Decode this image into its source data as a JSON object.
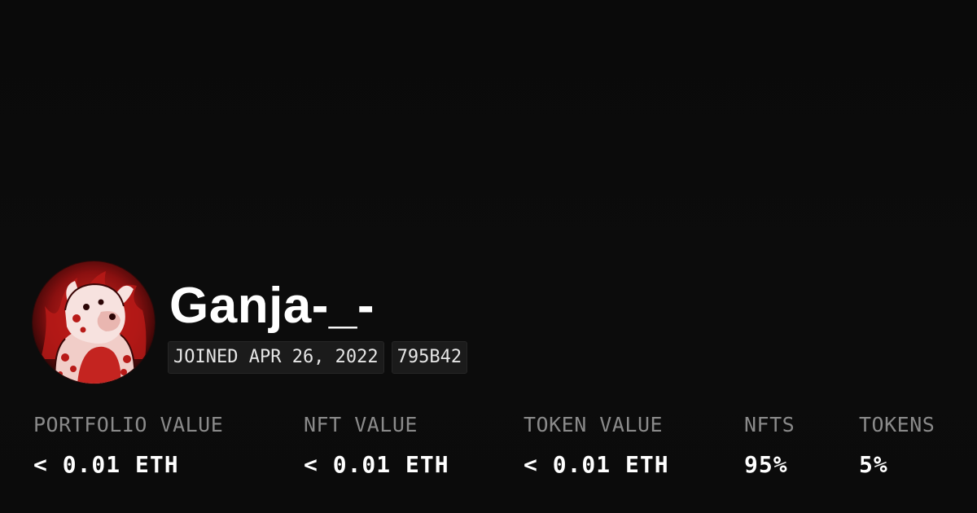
{
  "profile": {
    "username": "Ganja-_-",
    "joined": "JOINED APR 26, 2022",
    "address_short": "795B42",
    "avatar_icon": "avatar-image",
    "avatar_colors": {
      "base": "#1a0303",
      "dark_red": "#6e0c0c",
      "red": "#c8201e",
      "light": "#f4d7d4",
      "white": "#ffffff"
    }
  },
  "stats": [
    {
      "label": "PORTFOLIO VALUE",
      "value": "< 0.01 ETH"
    },
    {
      "label": "NFT VALUE",
      "value": "< 0.01 ETH"
    },
    {
      "label": "TOKEN VALUE",
      "value": "< 0.01 ETH"
    },
    {
      "label": "NFTS",
      "value": "95%"
    },
    {
      "label": "TOKENS",
      "value": "5%"
    }
  ]
}
